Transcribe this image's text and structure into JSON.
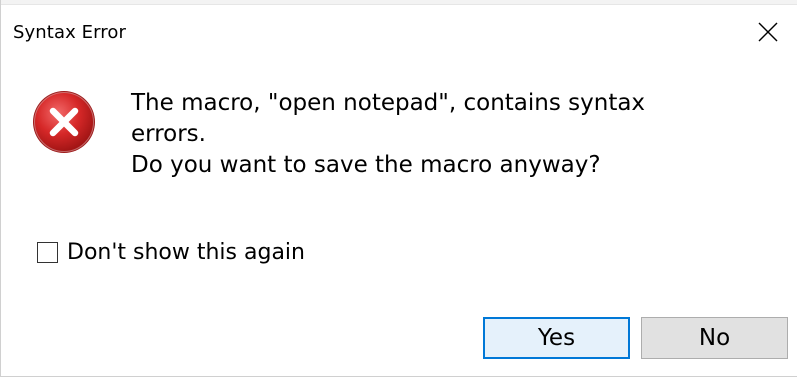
{
  "window": {
    "title": "Syntax Error",
    "close_icon": "close-icon"
  },
  "message": {
    "icon": "error-icon",
    "line1": "The macro, \"open notepad\", contains syntax",
    "line2": "errors.",
    "line3": "Do you want to save the macro anyway?"
  },
  "checkbox": {
    "label": "Don't show this again",
    "checked": false
  },
  "buttons": {
    "yes_label": "Yes",
    "no_label": "No"
  },
  "colors": {
    "error_red": "#d32f2f",
    "accent_blue": "#0078d7",
    "default_button_bg": "#e5f1fb",
    "button_bg": "#e1e1e1"
  }
}
